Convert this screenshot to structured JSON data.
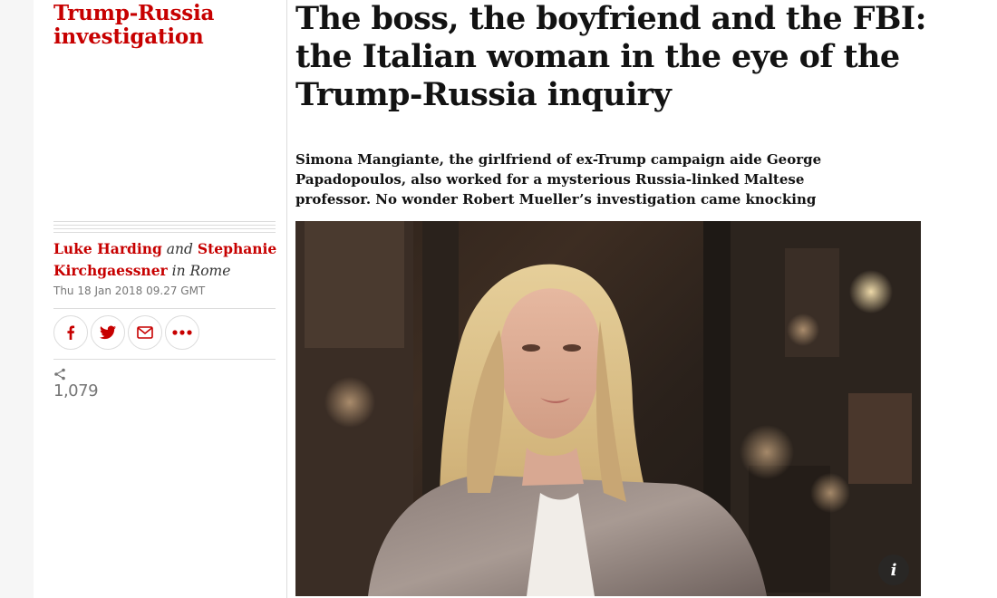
{
  "section": {
    "label_line1": "Trump-Russia",
    "label_line2": "investigation"
  },
  "article": {
    "headline_line1": "The boss, the boyfriend and the FBI:",
    "headline_line2": "the Italian woman in the eye of the",
    "headline_line3": "Trump-Russia inquiry",
    "standfirst_line1": "Simona Mangiante, the girlfriend of ex-Trump campaign aide George",
    "standfirst_line2": "Papadopoulos, also worked for a mysterious Russia-linked Maltese",
    "standfirst_line3": "professor. No wonder Robert Mueller’s investigation came knocking"
  },
  "byline": {
    "author1": "Luke Harding",
    "conjunction": "and",
    "author2_first": "Stephanie",
    "author2_last": "Kirchgaessner",
    "location": "in Rome",
    "date": "Thu 18 Jan 2018 09.27 GMT"
  },
  "share": {
    "buttons": [
      {
        "icon": "facebook-icon"
      },
      {
        "icon": "twitter-icon"
      },
      {
        "icon": "email-icon"
      },
      {
        "icon": "more-icon"
      }
    ],
    "count": "1,079"
  },
  "image": {
    "info_label": "i"
  },
  "colors": {
    "accent": "#c70000",
    "text": "#121212",
    "muted": "#767676",
    "rule": "#dcdcdc"
  }
}
